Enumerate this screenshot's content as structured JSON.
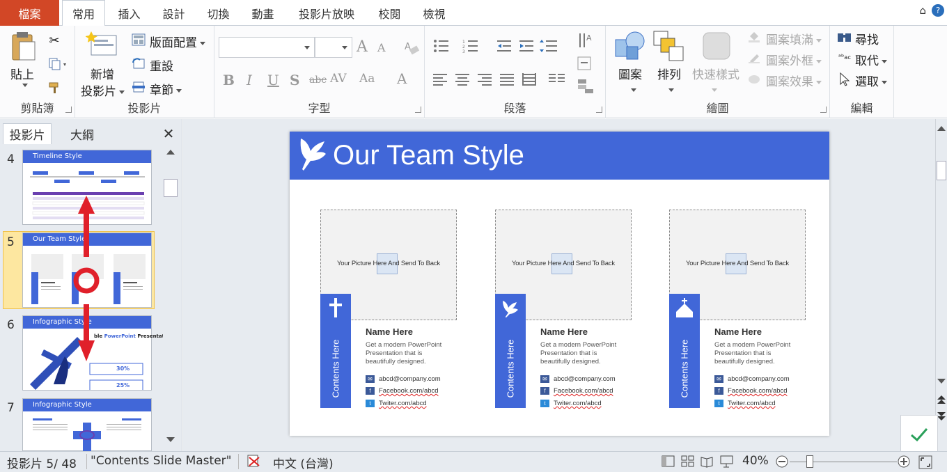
{
  "tabs": {
    "file": "檔案",
    "items": [
      "常用",
      "插入",
      "設計",
      "切換",
      "動畫",
      "投影片放映",
      "校閱",
      "檢視"
    ],
    "active": "常用"
  },
  "ribbon": {
    "clipboard": {
      "paste": "貼上",
      "label": "剪貼簿"
    },
    "slides": {
      "new_slide_1": "新增",
      "new_slide_2": "投影片",
      "layout": "版面配置",
      "reset": "重設",
      "section": "章節",
      "label": "投影片"
    },
    "font": {
      "label": "字型",
      "bold": "B",
      "italic": "I",
      "underline": "U",
      "shadow": "S",
      "strike": "abc",
      "spacing": "AV",
      "case": "Aa",
      "grow": "A",
      "shrink": "A",
      "color": "A"
    },
    "paragraph": {
      "label": "段落"
    },
    "drawing": {
      "shapes": "圖案",
      "arrange": "排列",
      "quick_styles": "快速樣式",
      "fill": "圖案填滿",
      "outline": "圖案外框",
      "effects": "圖案效果",
      "label": "繪圖"
    },
    "editing": {
      "find": "尋找",
      "replace": "取代",
      "select": "選取",
      "label": "編輯"
    }
  },
  "leftpane": {
    "tab_slides": "投影片",
    "tab_outline": "大綱",
    "thumbs": [
      {
        "num": "4",
        "title": "Timeline Style"
      },
      {
        "num": "5",
        "title": "Our Team Style"
      },
      {
        "num": "6",
        "title": "Infographic Style"
      },
      {
        "num": "7",
        "title": "Infographic Style"
      }
    ],
    "thumb6_pct1": "30%",
    "thumb6_pct2": "25%",
    "thumb6_text1": "ble",
    "thumb6_text2": "PowerPoint",
    "thumb6_text3": "Presentation"
  },
  "slide": {
    "title": "Our Team Style",
    "cards": [
      {
        "photo_text": "Your Picture Here And Send To Back",
        "side": "Contents Here",
        "name": "Name Here",
        "desc": "Get a modern PowerPoint Presentation that is beautifully designed.",
        "email": "abcd@company.com",
        "facebook": "Facebook.com/abcd",
        "twitter": "Twiter.com/abcd",
        "icon": "cross-icon"
      },
      {
        "photo_text": "Your Picture Here And Send To Back",
        "side": "Contents Here",
        "name": "Name Here",
        "desc": "Get a modern PowerPoint Presentation that is beautifully designed.",
        "email": "abcd@company.com",
        "facebook": "Facebook.com/abcd",
        "twitter": "Twiter.com/abcd",
        "icon": "dove-icon"
      },
      {
        "photo_text": "Your Picture Here And Send To Back",
        "side": "Contents Here",
        "name": "Name Here",
        "desc": "Get a modern PowerPoint Presentation that is beautifully designed.",
        "email": "abcd@company.com",
        "facebook": "Facebook.com/abcd",
        "twitter": "Twiter.com/abcd",
        "icon": "church-icon"
      }
    ]
  },
  "status": {
    "slide": "投影片 5/ 48",
    "theme": "\"Contents Slide Master\"",
    "language": "中文 (台灣)",
    "zoom": "40%"
  },
  "colors": {
    "accent": "#4167d8",
    "file_tab": "#d24726",
    "selection": "#fde7a0",
    "arrow": "#e0202a"
  }
}
